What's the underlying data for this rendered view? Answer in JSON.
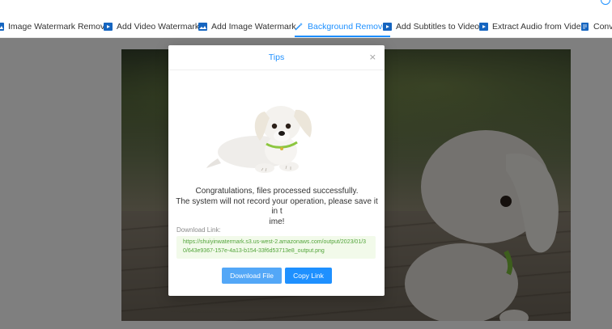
{
  "nav": {
    "tabs": [
      {
        "label": "Image Watermark Remover",
        "icon": "image-icon",
        "active": false
      },
      {
        "label": "Add Video Watermark",
        "icon": "video-icon",
        "active": false
      },
      {
        "label": "Add Image Watermark",
        "icon": "image-icon",
        "active": false
      },
      {
        "label": "Background Remover",
        "icon": "magic-wand-icon",
        "active": true
      },
      {
        "label": "Add Subtitles to Video",
        "icon": "video-icon",
        "active": false
      },
      {
        "label": "Extract Audio from Video",
        "icon": "video-icon",
        "active": false
      },
      {
        "label": "Conver",
        "icon": "document-icon",
        "active": false
      }
    ],
    "accent_color": "#1e90ff"
  },
  "modal": {
    "title": "Tips",
    "close_symbol": "×",
    "message_line1": "Congratulations, files processed successfully.",
    "message_line2": "The system will not record your operation, please save it in t",
    "message_line3": "ime!",
    "download_label": "Download Link:",
    "download_url": "https://shuiyinwatermark.s3.us-west-2.amazonaws.com/output/2023/01/30/643e9367-157e-4a13-b154-33f6d53713e8_output.png",
    "download_button": "Download File",
    "copy_button": "Copy Link"
  },
  "colors": {
    "link_green": "#52a43a",
    "link_bg": "#f2faea",
    "button_blue": "#1e90ff"
  }
}
